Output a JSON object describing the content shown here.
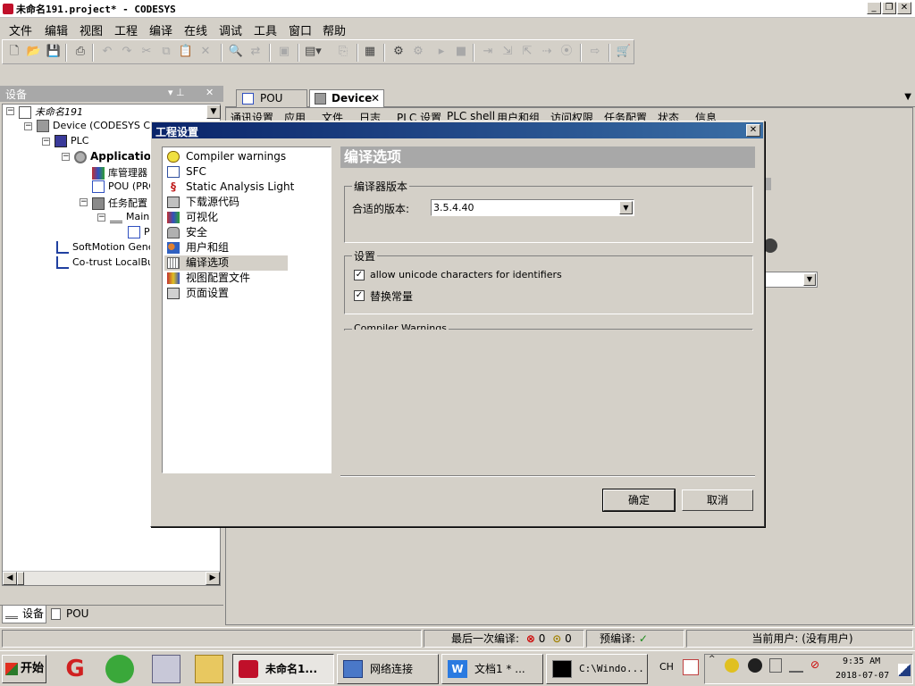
{
  "window": {
    "title": "未命名191.project* - CODESYS",
    "min_glyph": "_",
    "restore_glyph": "❐",
    "close_glyph": "✕"
  },
  "menu": [
    "文件",
    "编辑",
    "视图",
    "工程",
    "编译",
    "在线",
    "调试",
    "工具",
    "窗口",
    "帮助"
  ],
  "devices_panel": {
    "title": "设备",
    "pin_glyph": "▾ ⊥",
    "close_glyph": "✕",
    "tree": [
      {
        "label": "未命名191"
      },
      {
        "label": "Device (CODESYS Con"
      },
      {
        "label": "PLC"
      },
      {
        "label": "Application"
      },
      {
        "label": "库管理器"
      },
      {
        "label": "POU (PRG"
      },
      {
        "label": "任务配置"
      },
      {
        "label": "Main1"
      },
      {
        "label": "P"
      },
      {
        "label": "SoftMotion Genera"
      },
      {
        "label": "Co-trust LocalBus"
      }
    ],
    "bottom_tabs": [
      "设备",
      "POU"
    ]
  },
  "editor": {
    "tabs": [
      "POU",
      "Device"
    ],
    "device_subtabs": [
      "通讯设置",
      "应用",
      "文件",
      "日志",
      "PLC 设置",
      "PLC shell",
      "用户和组",
      "访问权限",
      "任务配置",
      "状态",
      "信息"
    ]
  },
  "dialog": {
    "title": "工程设置",
    "categories": [
      {
        "label": "Compiler warnings"
      },
      {
        "label": "SFC"
      },
      {
        "label": "Static Analysis Light"
      },
      {
        "label": "下载源代码"
      },
      {
        "label": "可视化"
      },
      {
        "label": "安全"
      },
      {
        "label": "用户和组"
      },
      {
        "label": "编译选项"
      },
      {
        "label": "视图配置文件"
      },
      {
        "label": "页面设置"
      }
    ],
    "selected_category": "编译选项",
    "section_title": "编译选项",
    "compiler_version_group": {
      "label": "编译器版本",
      "field_label": "合适的版本:",
      "value": "3.5.4.40"
    },
    "settings_group": {
      "label": "设置",
      "options": [
        {
          "label": "allow unicode characters for identifiers",
          "checked": true,
          "mark": "✓"
        },
        {
          "label": "替换常量",
          "checked": true,
          "mark": "✓"
        }
      ]
    },
    "warnings_group_label": "Compiler Warnings",
    "ok": "确定",
    "cancel": "取消"
  },
  "status_bar": {
    "last_compile_label": "最后一次编译:",
    "errors": "0",
    "warnings": "0",
    "precompile_label": "预编译:",
    "precompile_mark": "✓",
    "current_user": "当前用户: (没有用户)"
  },
  "taskbar": {
    "start": "开始",
    "tasks": [
      {
        "label": "未命名1..."
      },
      {
        "label": "网络连接"
      },
      {
        "label": "文档1 * ..."
      },
      {
        "label": "C:\\Windo..."
      }
    ],
    "tray_lang": "CH",
    "time": "9:35 AM",
    "date": "2018-07-07"
  }
}
